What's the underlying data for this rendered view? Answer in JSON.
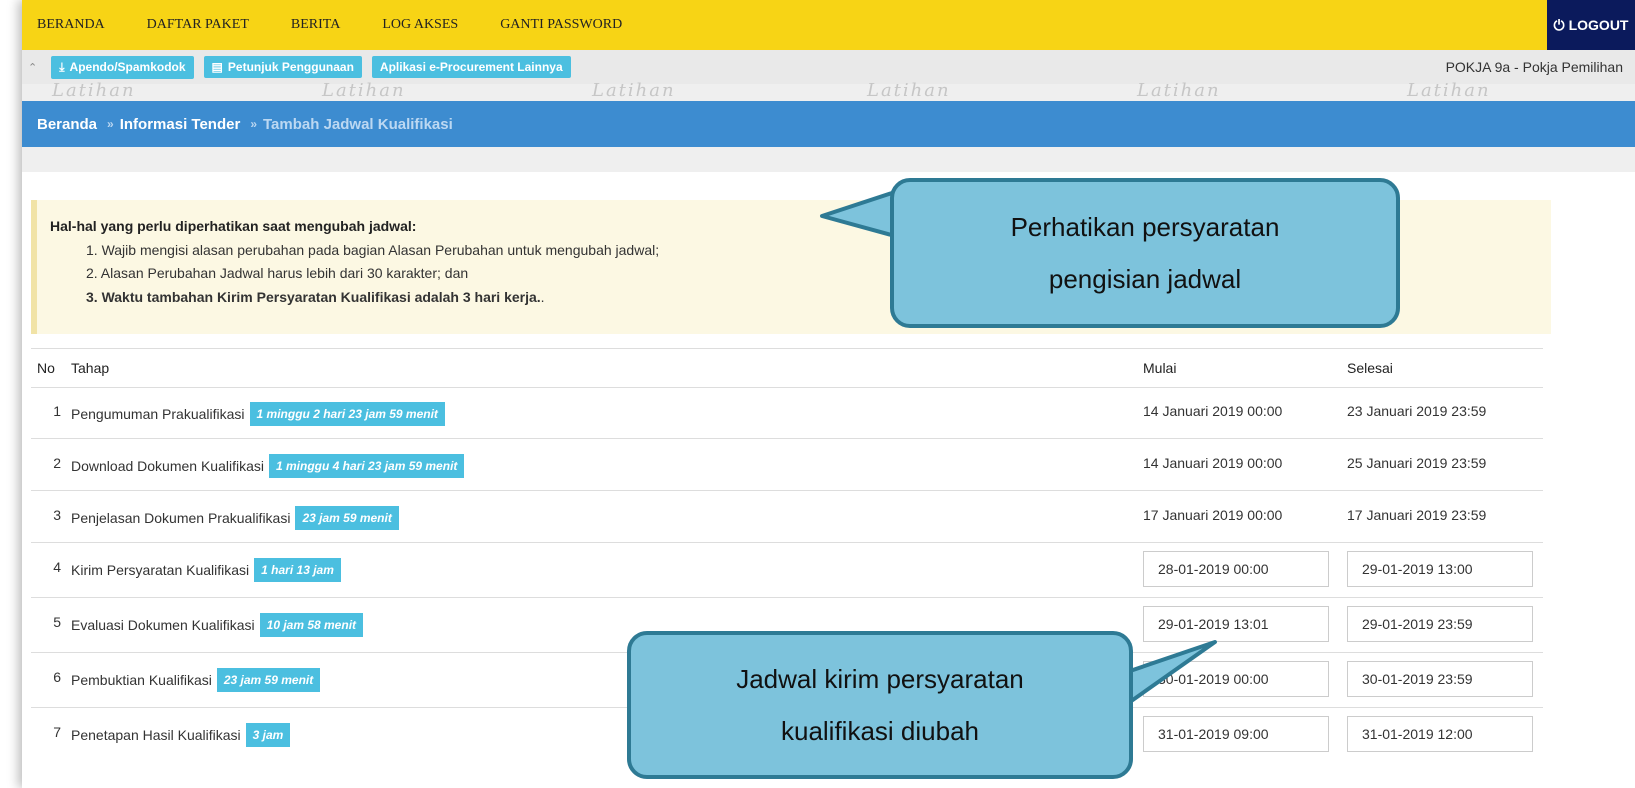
{
  "nav": {
    "items": [
      "BERANDA",
      "DAFTAR PAKET",
      "BERITA",
      "LOG AKSES",
      "GANTI PASSWORD"
    ],
    "logout": "LOGOUT"
  },
  "toolbar": {
    "apendo": "Apendo/Spamkodok",
    "petunjuk": "Petunjuk Penggunaan",
    "aplikasi": "Aplikasi e-Procurement Lainnya",
    "user": "POKJA 9a - Pokja Pemilihan"
  },
  "watermark_text": "Latihan",
  "breadcrumb": {
    "home": "Beranda",
    "info": "Informasi Tender",
    "current": "Tambah Jadwal Kualifikasi",
    "separator": "»"
  },
  "notice": {
    "title": "Hal-hal yang perlu diperhatikan saat mengubah jadwal:",
    "items": [
      "1. Wajib mengisi alasan perubahan pada bagian Alasan Perubahan untuk mengubah jadwal;",
      "2. Alasan Perubahan Jadwal harus lebih dari 30 karakter; dan",
      "3. Waktu tambahan Kirim Persyaratan Kualifikasi adalah 3 hari kerja.",
      "."
    ]
  },
  "table": {
    "headers": {
      "no": "No",
      "tahap": "Tahap",
      "mulai": "Mulai",
      "selesai": "Selesai"
    },
    "rows": [
      {
        "no": "1",
        "tahap": "Pengumuman Prakualifikasi",
        "durasi": "1 minggu 2 hari 23 jam 59 menit",
        "mulai": "14 Januari 2019 00:00",
        "selesai": "23 Januari 2019 23:59",
        "editable": false
      },
      {
        "no": "2",
        "tahap": "Download Dokumen Kualifikasi",
        "durasi": "1 minggu 4 hari 23 jam 59 menit",
        "mulai": "14 Januari 2019 00:00",
        "selesai": "25 Januari 2019 23:59",
        "editable": false
      },
      {
        "no": "3",
        "tahap": "Penjelasan Dokumen Prakualifikasi",
        "durasi": "23 jam 59 menit",
        "mulai": "17 Januari 2019 00:00",
        "selesai": "17 Januari 2019 23:59",
        "editable": false
      },
      {
        "no": "4",
        "tahap": "Kirim Persyaratan Kualifikasi",
        "durasi": "1 hari 13 jam",
        "mulai": "28-01-2019 00:00",
        "selesai": "29-01-2019 13:00",
        "editable": true
      },
      {
        "no": "5",
        "tahap": "Evaluasi Dokumen Kualifikasi",
        "durasi": "10 jam 58 menit",
        "mulai": "29-01-2019 13:01",
        "selesai": "29-01-2019 23:59",
        "editable": true
      },
      {
        "no": "6",
        "tahap": "Pembuktian Kualifikasi",
        "durasi": "23 jam 59 menit",
        "mulai": "30-01-2019 00:00",
        "selesai": "30-01-2019 23:59",
        "editable": true
      },
      {
        "no": "7",
        "tahap": "Penetapan Hasil Kualifikasi",
        "durasi": "3 jam",
        "mulai": "31-01-2019 09:00",
        "selesai": "31-01-2019 12:00",
        "editable": true
      }
    ]
  },
  "callouts": {
    "top": [
      "Perhatikan persyaratan",
      "pengisian jadwal"
    ],
    "bottom": [
      "Jadwal kirim persyaratan",
      "kualifikasi diubah"
    ]
  },
  "colors": {
    "nav_bg": "#f7d415",
    "logout_bg": "#0b1a5c",
    "breadcrumb_bg": "#3d8cd0",
    "badge_bg": "#4bbfe0",
    "callout_bg": "#7dc3dc",
    "callout_border": "#2e7a94"
  }
}
